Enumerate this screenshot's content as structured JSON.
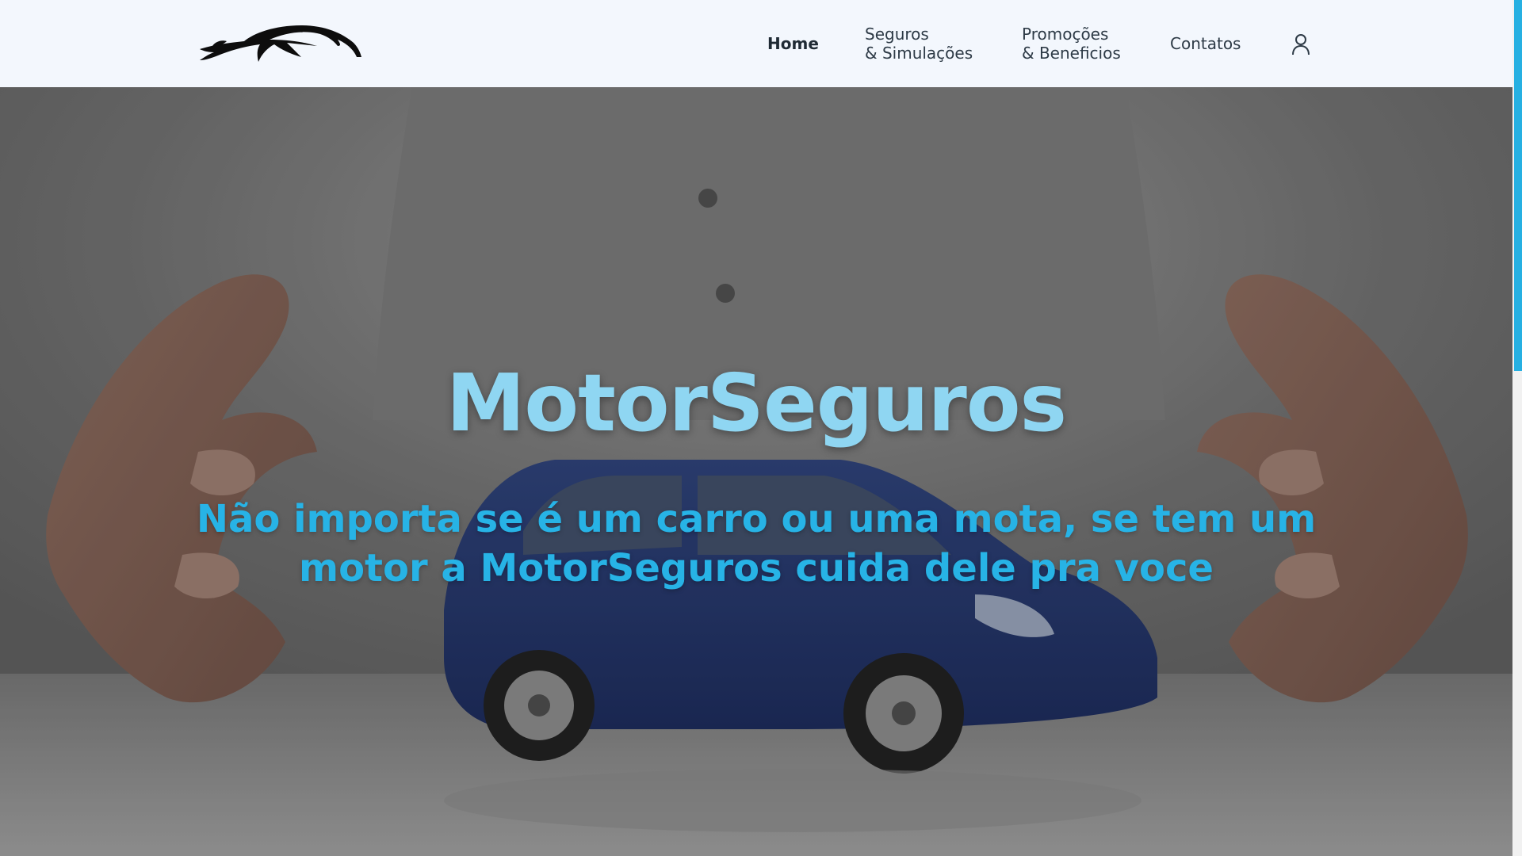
{
  "header": {
    "logo_alt": "logo",
    "nav": {
      "home": "Home",
      "seguros_line1": "Seguros",
      "seguros_line2": "& Simulações",
      "promo_line1": "Promoções",
      "promo_line2": "& Beneficios",
      "contatos": "Contatos"
    },
    "user_icon": "user-icon"
  },
  "hero": {
    "title": "MotorSeguros",
    "subtitle": "Não importa se é um carro ou uma mota, se tem um motor a MotorSeguros cuida dele pra voce",
    "background": "hands-protecting-blue-car"
  },
  "colors": {
    "header_bg": "#f3f7fd",
    "title": "#8fd6f2",
    "subtitle": "#27b3e6",
    "nav_text": "#2d3a46",
    "scrollbar_thumb": "#26b0e2"
  }
}
